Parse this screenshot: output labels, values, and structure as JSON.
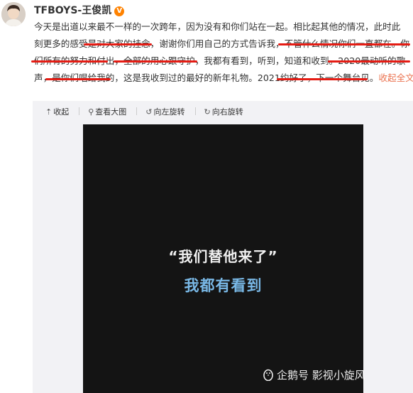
{
  "post": {
    "author": "TFBOYS-王俊凯",
    "verified_badge": "V",
    "lines": [
      "今天是出道以来最不一样的一次跨年，因为没有和你们站在一起。相比起其他的情况，此时此",
      "刻更多的感受是对大家的挂念，谢谢你们用自己的方式告诉我，不管什么情况你们一直都在。你",
      "们所有的努力和付出，全部的用心跟守护，我都有看到，听到，知道和收到。2020最动听的歌",
      "声，是你们唱给我的，这是我收到过的最好的新年礼物。2021约好了，下一个舞台见。"
    ],
    "expand_label": "收起全文"
  },
  "media_toolbar": {
    "collapse": "收起",
    "view_large": "查看大图",
    "rotate_left": "向左旋转",
    "rotate_right": "向右旋转"
  },
  "video": {
    "quote": "“我们替他来了”",
    "subtitle": "我都有看到",
    "watermark": "企鹅号 影视小旋风"
  },
  "colors": {
    "underline": "#e51c14",
    "expand_link": "#eb7350",
    "subtitle": "#79b8e6"
  },
  "icons": [
    "avatar",
    "verified-badge-icon",
    "collapse-icon",
    "search-icon",
    "rotate-left-icon",
    "rotate-right-icon",
    "penguin-icon"
  ]
}
